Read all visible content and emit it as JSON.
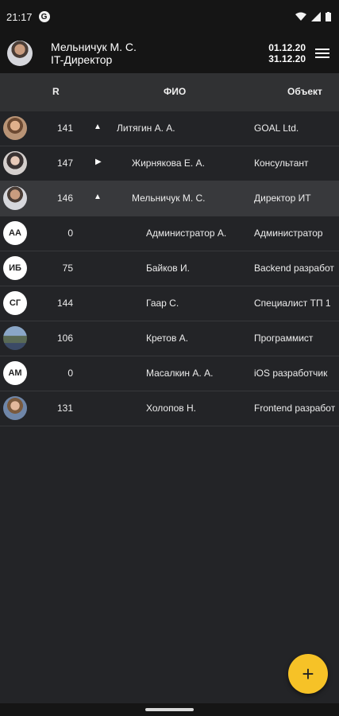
{
  "status_bar": {
    "time": "21:17",
    "notification_glyph": "G",
    "icons": [
      "wifi-icon",
      "signal-icon",
      "battery-icon"
    ]
  },
  "header": {
    "user_name": "Мельничук М. С.",
    "user_role": "IT-Директор",
    "date_from": "01.12.20",
    "date_to": "31.12.20"
  },
  "table": {
    "columns": {
      "r": "R",
      "fio": "ФИО",
      "object": "Объект"
    },
    "rows": [
      {
        "avatar": "photo",
        "initials": "",
        "r": "141",
        "toggle": "▲",
        "name": "Литягин А. А.",
        "object": "GOAL Ltd."
      },
      {
        "avatar": "photo",
        "initials": "",
        "r": "147",
        "toggle": "▶",
        "name": "Жирнякова Е. А.",
        "object": "Консультант"
      },
      {
        "avatar": "photo",
        "initials": "",
        "r": "146",
        "toggle": "▲",
        "name": "Мельничук М. С.",
        "object": "Директор ИТ"
      },
      {
        "avatar": "initials",
        "initials": "АА",
        "r": "0",
        "toggle": "",
        "name": "Администратор А.",
        "object": "Администратор"
      },
      {
        "avatar": "initials",
        "initials": "ИБ",
        "r": "75",
        "toggle": "",
        "name": "Байков И.",
        "object": "Backend разработ"
      },
      {
        "avatar": "initials",
        "initials": "СГ",
        "r": "144",
        "toggle": "",
        "name": "Гаар С.",
        "object": "Специалист ТП 1"
      },
      {
        "avatar": "photo",
        "initials": "",
        "r": "106",
        "toggle": "",
        "name": "Кретов А.",
        "object": "Программист"
      },
      {
        "avatar": "initials",
        "initials": "АМ",
        "r": "0",
        "toggle": "",
        "name": "Масалкин А. А.",
        "object": "iOS разработчик"
      },
      {
        "avatar": "photo",
        "initials": "",
        "r": "131",
        "toggle": "",
        "name": "Холопов Н.",
        "object": "Frontend разработ"
      }
    ]
  },
  "fab": {
    "label": "+"
  },
  "colors": {
    "accent": "#f6c227",
    "background": "#232427",
    "header": "#151515"
  }
}
